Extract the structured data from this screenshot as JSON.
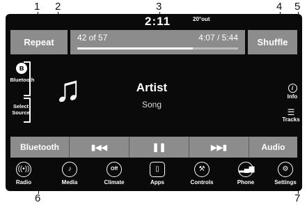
{
  "callouts": [
    "1",
    "2",
    "3",
    "4",
    "5",
    "6",
    "7"
  ],
  "status": {
    "time": "2:11",
    "temp": "20°out"
  },
  "top": {
    "repeat_label": "Repeat",
    "shuffle_label": "Shuffle",
    "track_position": "42 of 57",
    "track_time": "4:07 / 5:44",
    "progress_fraction": 0.72
  },
  "source": {
    "bluetooth_label": "Bluetooth",
    "select_source_label": "Select\nSource"
  },
  "now_playing": {
    "artist": "Artist",
    "song": "Song"
  },
  "right": {
    "info_label": "Info",
    "tracks_label": "Tracks"
  },
  "bottom": {
    "bluetooth_label": "Bluetooth",
    "audio_label": "Audio"
  },
  "nav": [
    {
      "label": "Radio",
      "icon": "radio-icon"
    },
    {
      "label": "Media",
      "icon": "media-icon"
    },
    {
      "label": "Climate",
      "icon": "climate-icon",
      "glyph": "Off"
    },
    {
      "label": "Apps",
      "icon": "apps-icon"
    },
    {
      "label": "Controls",
      "icon": "controls-icon"
    },
    {
      "label": "Phone",
      "icon": "phone-icon"
    },
    {
      "label": "Settings",
      "icon": "settings-icon"
    }
  ]
}
